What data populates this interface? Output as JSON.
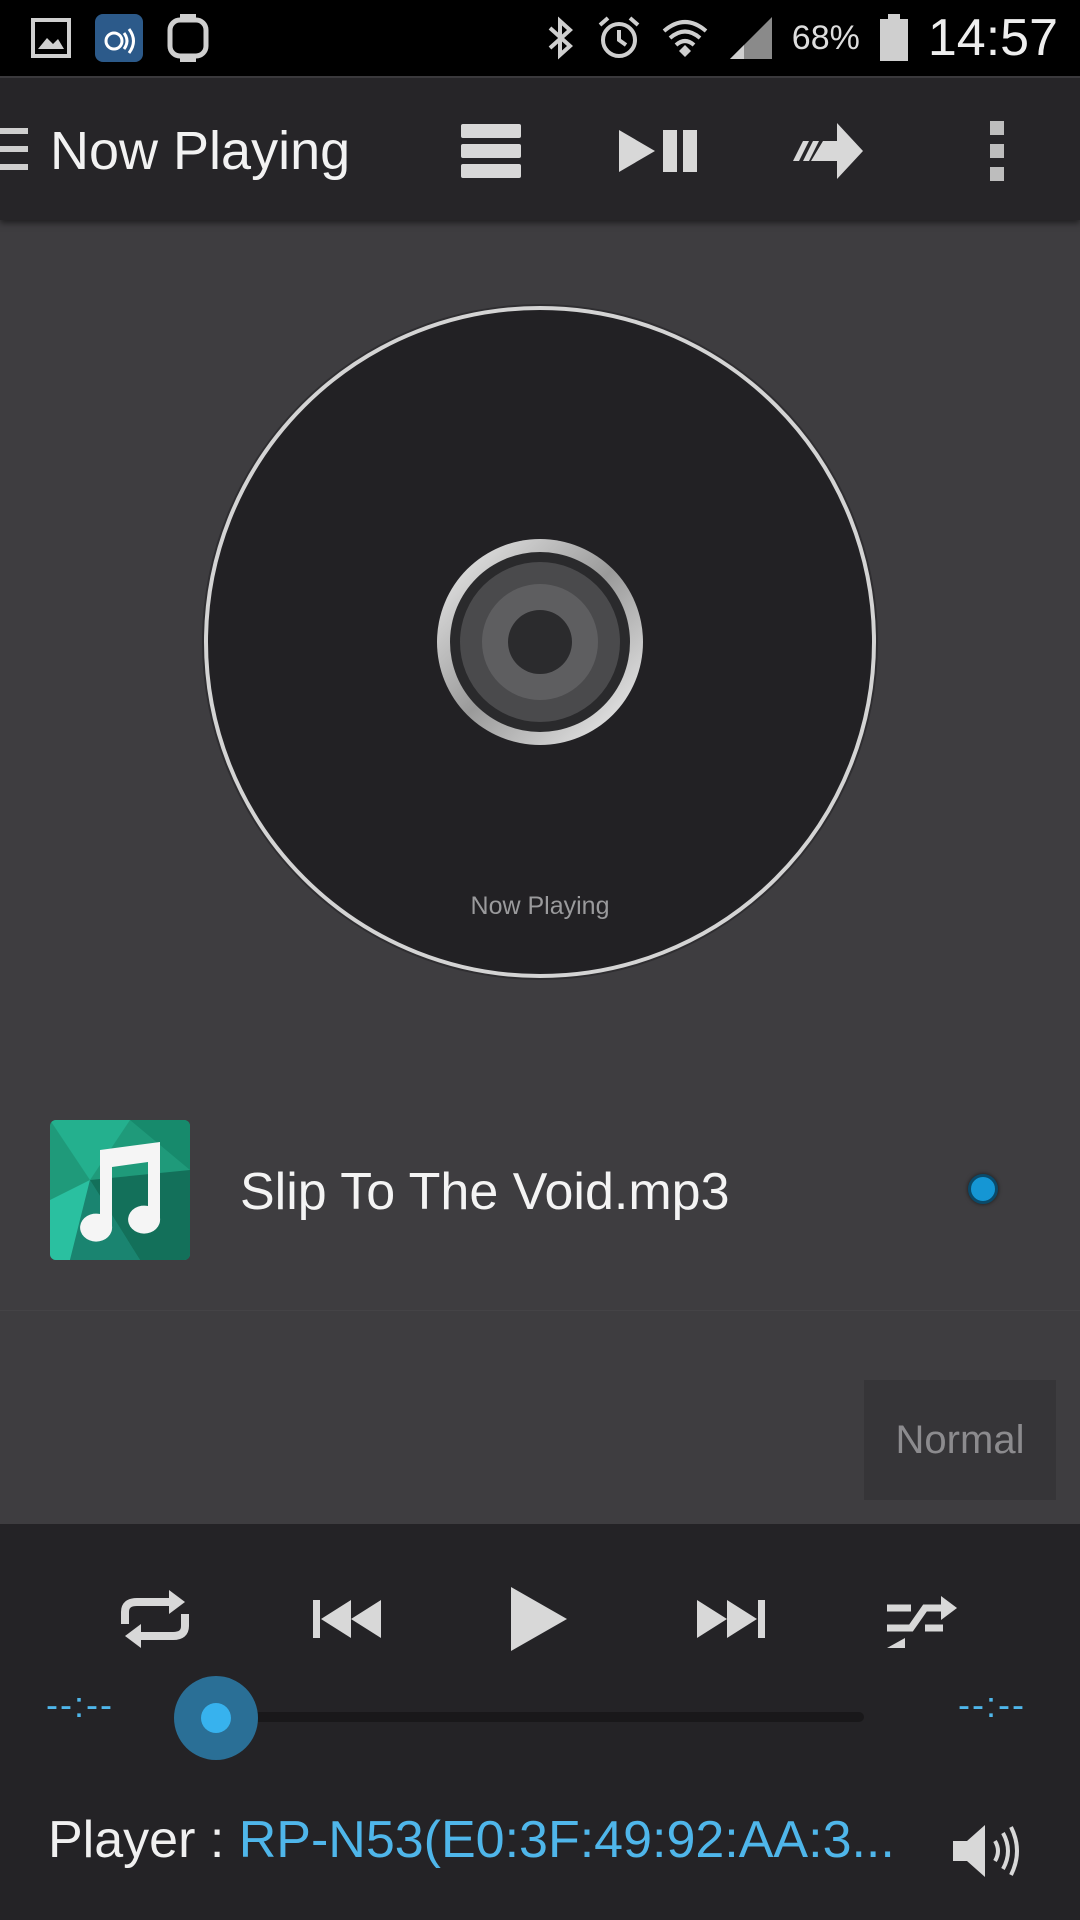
{
  "status_bar": {
    "battery": "68%",
    "time": "14:57",
    "icons": [
      "gallery-icon",
      "asus-audio-icon",
      "smartwatch-icon",
      "bluetooth-icon",
      "alarm-icon",
      "wifi-icon",
      "signal-icon",
      "battery-icon"
    ]
  },
  "toolbar": {
    "title": "Now Playing",
    "actions": [
      "playlist-icon",
      "play-pause-icon",
      "share-forward-icon",
      "overflow-menu-icon"
    ]
  },
  "disc": {
    "label": "Now Playing"
  },
  "track": {
    "name": "Slip To The Void.mp3",
    "art_icon": "music-note-icon",
    "selected": true
  },
  "mode": {
    "label": "Normal"
  },
  "controls": {
    "buttons": [
      "repeat-icon",
      "previous-icon",
      "play-icon",
      "next-icon",
      "shuffle-icon"
    ],
    "elapsed": "--:--",
    "total": "--:--",
    "progress": 0
  },
  "player": {
    "label": "Player : ",
    "value": "RP-N53(E0:3F:49:92:AA:3..."
  },
  "colors": {
    "accent": "#4fb6ea",
    "background": "#3e3d40",
    "toolbar": "#262528",
    "controls": "#242326"
  }
}
